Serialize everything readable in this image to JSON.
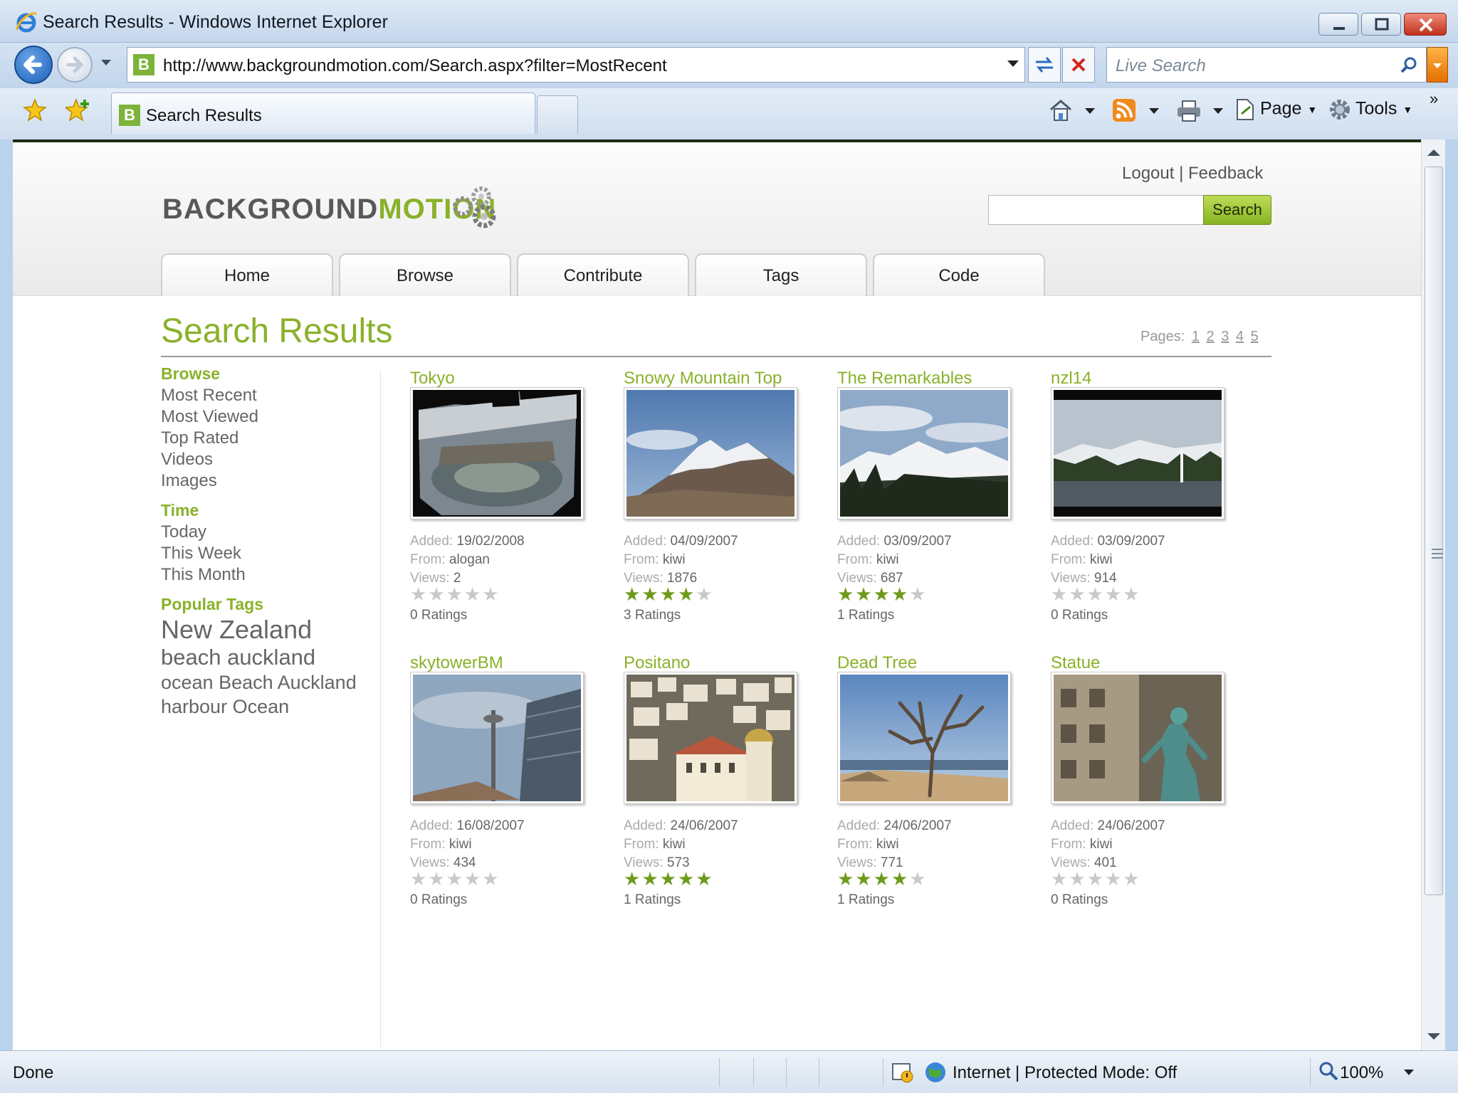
{
  "window": {
    "title": "Search Results - Windows Internet Explorer"
  },
  "addressbar": {
    "url": "http://www.backgroundmotion.com/Search.aspx?filter=MostRecent",
    "search_placeholder": "Live Search"
  },
  "tabs": {
    "active_label": "Search Results"
  },
  "commandbar": {
    "page_label": "Page",
    "tools_label": "Tools"
  },
  "site": {
    "logo_part1": "BACKGROUND",
    "logo_part2": "MOTION",
    "logout_label": "Logout",
    "separator": "|",
    "feedback_label": "Feedback",
    "search_button": "Search",
    "nav": [
      {
        "label": "Home"
      },
      {
        "label": "Browse"
      },
      {
        "label": "Contribute"
      },
      {
        "label": "Tags"
      },
      {
        "label": "Code"
      }
    ]
  },
  "main": {
    "title": "Search Results",
    "pages_label": "Pages:",
    "pages": [
      "1",
      "2",
      "3",
      "4",
      "5"
    ]
  },
  "sidebar": {
    "browse_heading": "Browse",
    "browse_links": [
      "Most Recent",
      "Most Viewed",
      "Top Rated",
      "Videos",
      "Images"
    ],
    "time_heading": "Time",
    "time_links": [
      "Today",
      "This Week",
      "This Month"
    ],
    "tags_heading": "Popular Tags",
    "tags": [
      "New Zealand",
      "beach auckland",
      "ocean Beach Auckland",
      "harbour Ocean"
    ]
  },
  "labels": {
    "added": "Added:",
    "from": "From:",
    "views": "Views:",
    "ratings_suffix": "Ratings"
  },
  "results": [
    {
      "title": "Tokyo",
      "added": "19/02/2008",
      "from": "alogan",
      "views": "2",
      "rating": 0,
      "ratings_text": "0 Ratings"
    },
    {
      "title": "Snowy Mountain Top",
      "added": "04/09/2007",
      "from": "kiwi",
      "views": "1876",
      "rating": 4,
      "ratings_text": "3 Ratings"
    },
    {
      "title": "The Remarkables",
      "added": "03/09/2007",
      "from": "kiwi",
      "views": "687",
      "rating": 4,
      "ratings_text": "1 Ratings"
    },
    {
      "title": "nzl14",
      "added": "03/09/2007",
      "from": "kiwi",
      "views": "914",
      "rating": 0,
      "ratings_text": "0 Ratings"
    },
    {
      "title": "skytowerBM",
      "added": "16/08/2007",
      "from": "kiwi",
      "views": "434",
      "rating": 0,
      "ratings_text": "0 Ratings"
    },
    {
      "title": "Positano",
      "added": "24/06/2007",
      "from": "kiwi",
      "views": "573",
      "rating": 5,
      "ratings_text": "1 Ratings"
    },
    {
      "title": "Dead Tree",
      "added": "24/06/2007",
      "from": "kiwi",
      "views": "771",
      "rating": 4,
      "ratings_text": "1 Ratings"
    },
    {
      "title": "Statue",
      "added": "24/06/2007",
      "from": "kiwi",
      "views": "401",
      "rating": 0,
      "ratings_text": "0 Ratings"
    }
  ],
  "statusbar": {
    "status": "Done",
    "zone": "Internet | Protected Mode: Off",
    "zoom": "100%"
  },
  "colors": {
    "brand_green": "#8ab12a",
    "star_on": "#6e9a1a",
    "star_off": "#c9c9c9"
  }
}
